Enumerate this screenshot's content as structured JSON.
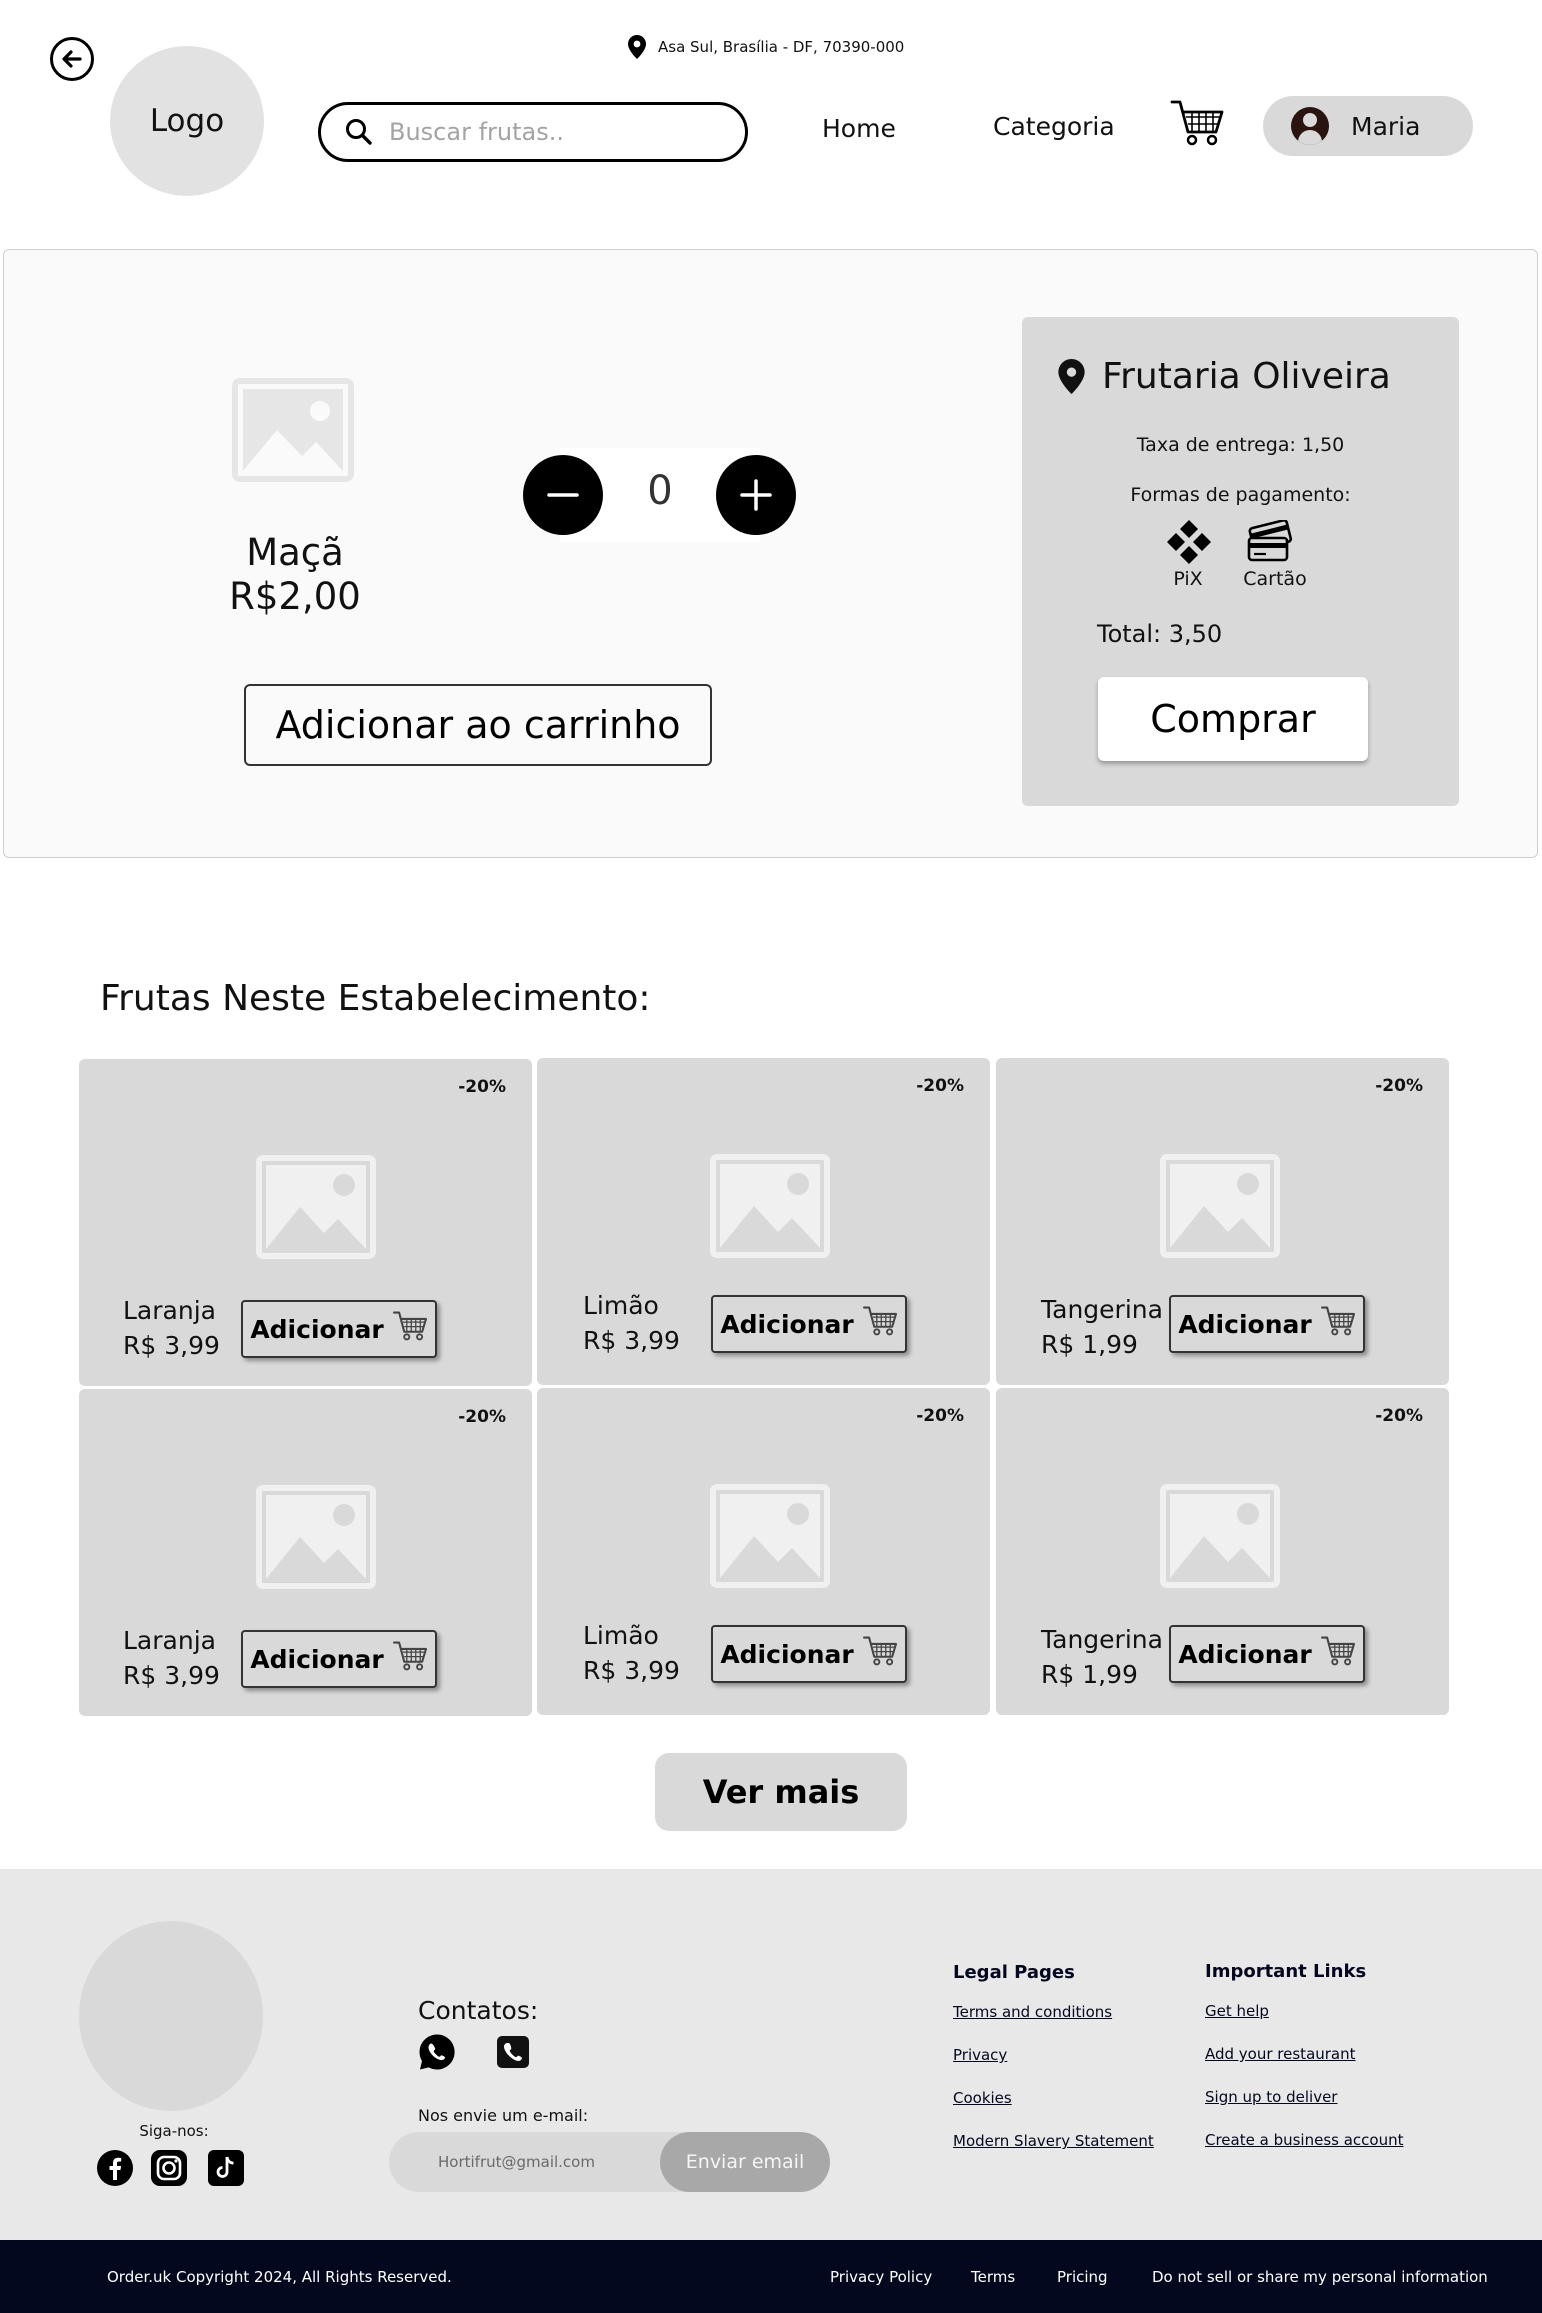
{
  "header": {
    "logo_text": "Logo",
    "location": "Asa Sul, Brasília - DF, 70390-000",
    "search_placeholder": "Buscar frutas..",
    "nav": {
      "home": "Home",
      "category": "Categoria"
    },
    "user_name": "Maria"
  },
  "product": {
    "name": "Maçã",
    "price": "R$2,00",
    "quantity": "0",
    "add_to_cart_label": "Adicionar ao carrinho"
  },
  "store": {
    "name": "Frutaria Oliveira",
    "delivery_fee": "Taxa de entrega: 1,50",
    "payment_title": "Formas de pagamento:",
    "payment_methods": [
      "PiX",
      "Cartão"
    ],
    "total": "Total: 3,50",
    "buy_label": "Comprar"
  },
  "fruits_section": {
    "title": "Frutas Neste Estabelecimento:",
    "add_label": "Adicionar",
    "items": [
      {
        "name": "Laranja",
        "price": "R$ 3,99",
        "discount": "-20%"
      },
      {
        "name": "Limão",
        "price": "R$ 3,99",
        "discount": "-20%"
      },
      {
        "name": "Tangerina",
        "price": "R$ 1,99",
        "discount": "-20%"
      },
      {
        "name": "Laranja",
        "price": "R$ 3,99",
        "discount": "-20%"
      },
      {
        "name": "Limão",
        "price": "R$ 3,99",
        "discount": "-20%"
      },
      {
        "name": "Tangerina",
        "price": "R$ 1,99",
        "discount": "-20%"
      }
    ],
    "more_label": "Ver mais"
  },
  "footer": {
    "follow_label": "Siga-nos:",
    "contacts_title": "Contatos:",
    "email_prompt": "Nos envie um e-mail:",
    "email_placeholder": "Hortifrut@gmail.com",
    "email_button": "Enviar email",
    "legal": {
      "title": "Legal Pages",
      "links": [
        "Terms and conditions",
        "Privacy",
        "Cookies",
        "Modern Slavery Statement"
      ]
    },
    "important": {
      "title": "Important Links",
      "links": [
        "Get help",
        "Add your restaurant",
        "Sign up to deliver",
        "Create a business account"
      ]
    },
    "copyright": "Order.uk Copyright 2024, All Rights Reserved.",
    "bottom_links": [
      "Privacy Policy",
      "Terms",
      "Pricing",
      "Do not sell or share my personal information"
    ]
  },
  "icons": {
    "back": "arrow-left-circle-icon",
    "location": "map-pin-icon",
    "search": "search-icon",
    "cart": "shopping-cart-icon",
    "user": "user-avatar-icon",
    "pix": "pix-icon",
    "card": "credit-card-icon",
    "whatsapp": "whatsapp-icon",
    "phone": "phone-icon",
    "facebook": "facebook-icon",
    "instagram": "instagram-icon",
    "tiktok": "tiktok-icon"
  },
  "colors": {
    "panel_gray": "#d9d9d9",
    "footer_bg": "#e8e8e8",
    "bottom_bar": "#03081f"
  }
}
